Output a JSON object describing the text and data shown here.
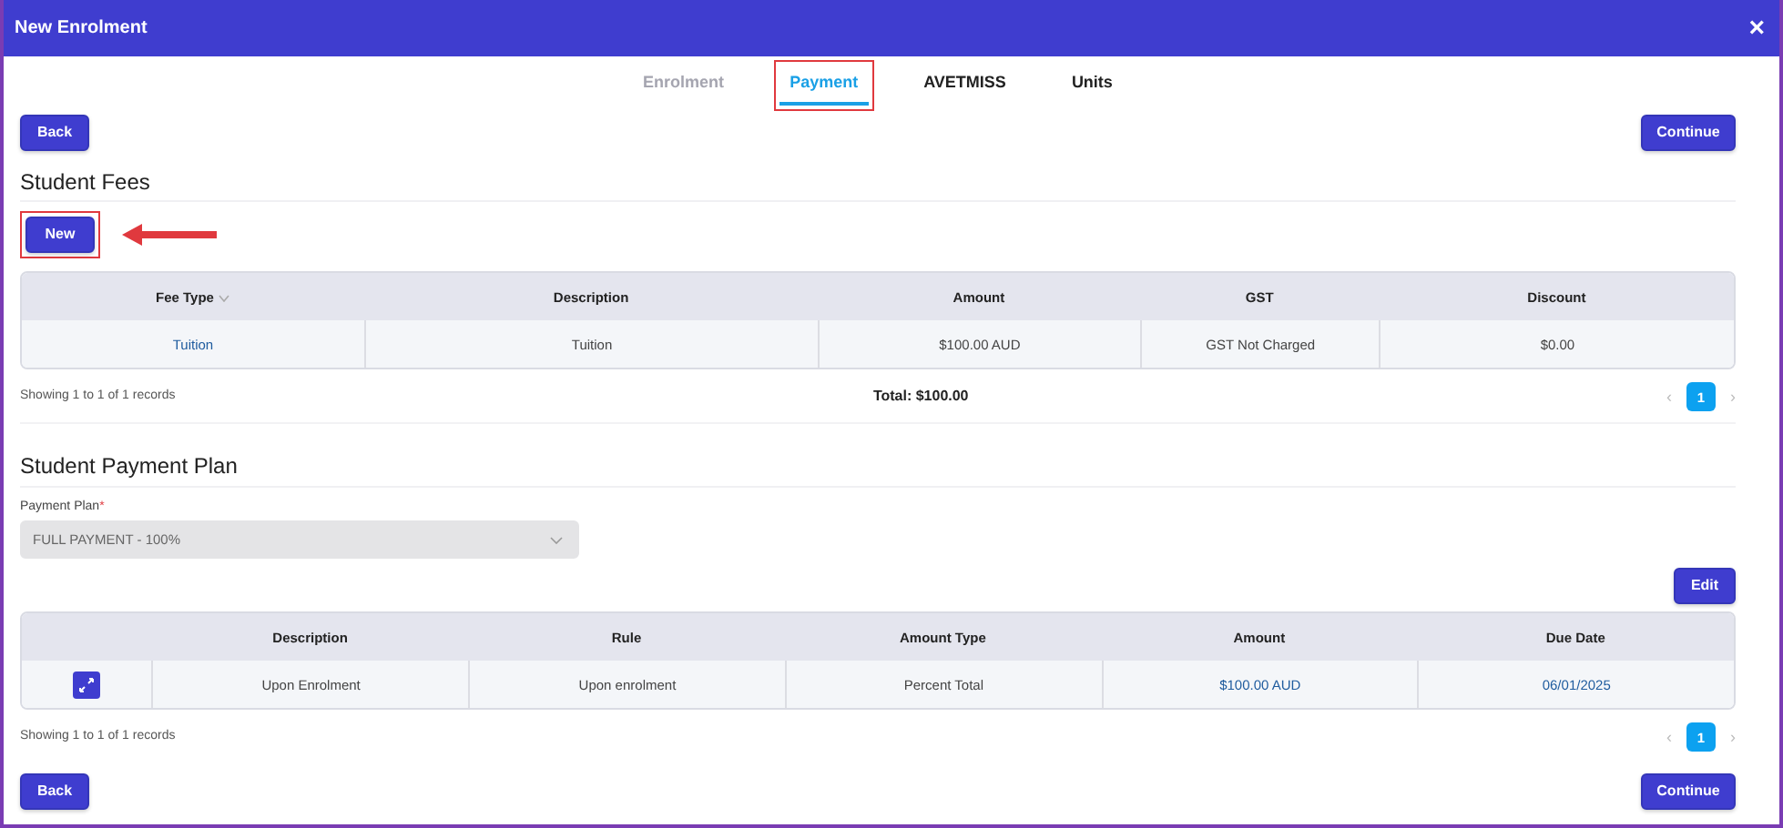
{
  "window": {
    "title": "New Enrolment",
    "close": "×"
  },
  "tabs": [
    {
      "label": "Enrolment",
      "selected": false,
      "disabled": true,
      "highlighted": false
    },
    {
      "label": "Payment",
      "selected": true,
      "disabled": false,
      "highlighted": true
    },
    {
      "label": "AVETMISS",
      "selected": false,
      "disabled": false,
      "highlighted": false
    },
    {
      "label": "Units",
      "selected": false,
      "disabled": false,
      "highlighted": false
    }
  ],
  "top_actions": {
    "back": "Back",
    "continue": "Continue"
  },
  "student_fees": {
    "title": "Student Fees",
    "new_button": {
      "label": "New",
      "highlighted": true
    },
    "table": {
      "columns": [
        {
          "label": "Fee Type",
          "sortable": true
        },
        {
          "label": "Description",
          "sortable": false
        },
        {
          "label": "Amount",
          "sortable": false
        },
        {
          "label": "GST",
          "sortable": false
        },
        {
          "label": "Discount",
          "sortable": false
        }
      ],
      "rows": [
        {
          "cells": [
            "Tuition",
            "Tuition",
            "$100.00 AUD",
            "GST Not Charged",
            "$0.00"
          ]
        }
      ]
    },
    "summary": "Showing 1 to 1 of 1 records",
    "total": "Total: $100.00",
    "pagination": {
      "prev": "‹",
      "next": "›",
      "pages": [
        {
          "label": "1",
          "selected": true
        }
      ]
    }
  },
  "payment_plan": {
    "title": "Student Payment Plan",
    "field": {
      "label": "Payment Plan",
      "required_mark": "*",
      "value": "FULL PAYMENT - 100%",
      "disabled": true
    },
    "edit_button": "Edit",
    "table": {
      "columns": [
        {
          "label": "Description"
        },
        {
          "label": "Rule"
        },
        {
          "label": "Amount Type"
        },
        {
          "label": "Amount"
        },
        {
          "label": "Due Date"
        }
      ],
      "rows": [
        {
          "cells": [
            "Upon Enrolment",
            "Upon enrolment",
            "Percent Total",
            "$100.00 AUD",
            "06/01/2025"
          ]
        }
      ]
    },
    "summary": "Showing 1 to 1 of 1 records",
    "pagination": {
      "prev": "‹",
      "next": "›",
      "pages": [
        {
          "label": "1",
          "selected": true
        }
      ]
    }
  },
  "bottom_actions": {
    "back": "Back",
    "continue": "Continue"
  }
}
